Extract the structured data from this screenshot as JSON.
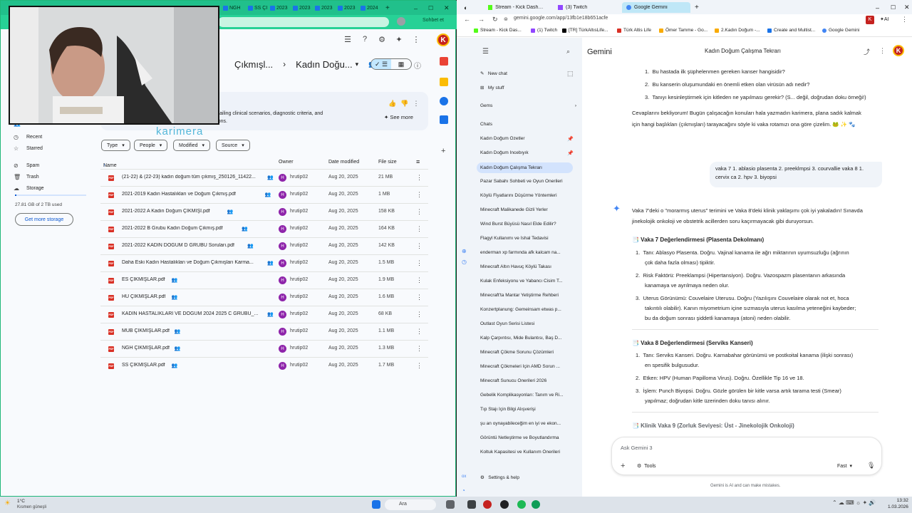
{
  "drive": {
    "tabs": [
      "NGH",
      "SS ÇI",
      "2023",
      "2023",
      "2023",
      "2023",
      "2024"
    ],
    "share_label": "Sohbet et",
    "avatar": "K",
    "breadcrumb": [
      "Çıkmışl...",
      "Kadın Doğu..."
    ],
    "card_text1": "ns detailing clinical scenarios, diagnostic criteria, and",
    "card_text2": "onditions.",
    "see_more": "See more",
    "watermark": "karimera",
    "nav": {
      "shared": "Shared with me",
      "recent": "Recent",
      "starred": "Starred",
      "spam": "Spam",
      "trash": "Trash",
      "storage": "Storage",
      "storage_text": "27.81 GB of 2 TB used",
      "storage_fraction": 0.0139,
      "get_storage": "Get more storage"
    },
    "chips": [
      "Type",
      "People",
      "Modified",
      "Source"
    ],
    "columns": {
      "name": "Name",
      "owner": "Owner",
      "date": "Date modified",
      "size": "File size"
    },
    "files": [
      {
        "name": "(21-22) & (22-23) kadın doğum tüm çıkmış_250126_11422...",
        "owner": "hrutip02",
        "date": "Aug 20, 2025",
        "size": "21 MB"
      },
      {
        "name": "2021-2019 Kadın Hastalıkları ve Doğum Çıkmış.pdf",
        "owner": "hrutip02",
        "date": "Aug 20, 2025",
        "size": "1 MB"
      },
      {
        "name": "2021-2022 A Kadın Doğum ÇIKMIŞI.pdf",
        "owner": "hrutip02",
        "date": "Aug 20, 2025",
        "size": "158 KB"
      },
      {
        "name": "2021-2022 B Grubu Kadın Doğum Çıkmış.pdf",
        "owner": "hrutip02",
        "date": "Aug 20, 2025",
        "size": "164 KB"
      },
      {
        "name": "2021-2022 KADIN DOĞUM D GRUBU Soruları.pdf",
        "owner": "hrutip02",
        "date": "Aug 20, 2025",
        "size": "142 KB"
      },
      {
        "name": "Daha Eski Kadın Hastalıkları ve Doğum Çıkmışları Karma...",
        "owner": "hrutip02",
        "date": "Aug 20, 2025",
        "size": "1.5 MB"
      },
      {
        "name": "ES ÇIKMIŞLAR.pdf",
        "owner": "hrutip02",
        "date": "Aug 20, 2025",
        "size": "1.9 MB"
      },
      {
        "name": "HU ÇIKMIŞLAR.pdf",
        "owner": "hrutip02",
        "date": "Aug 20, 2025",
        "size": "1.6 MB"
      },
      {
        "name": "KADIN HASTALIKLARI VE DOĞUM 2024 2025  C GRUBU_...",
        "owner": "hrutip02",
        "date": "Aug 20, 2025",
        "size": "68 KB"
      },
      {
        "name": "MUB ÇIKMIŞLAR.pdf",
        "owner": "hrutip02",
        "date": "Aug 20, 2025",
        "size": "1.1 MB"
      },
      {
        "name": "NGH ÇIKMIŞLAR.pdf",
        "owner": "hrutip02",
        "date": "Aug 20, 2025",
        "size": "1.3 MB"
      },
      {
        "name": "SS ÇIKMIŞLAR.pdf",
        "owner": "hrutip02",
        "date": "Aug 20, 2025",
        "size": "1.7 MB"
      }
    ]
  },
  "gemini_browser": {
    "tabs": [
      "Stream - Kick Dashboard",
      "(3) Twitch",
      "Google Gemini"
    ],
    "url": "gemini.google.com/app/13fb1e18b651acfe",
    "bookmarks": [
      "Stream - Kick Das...",
      "(1) Twitch",
      "[TR] TürkAltısLife...",
      "Türk Altis Life",
      "Ömer Tamme - Go...",
      "2.Kadın Doğum -...",
      "Create and Multist...",
      "Google Gemini"
    ],
    "colors": {
      "accent": "#0b57d0",
      "sidebar": "#f0f4f9",
      "user_bubble": "#f0f4f9"
    }
  },
  "gemini": {
    "app_title": "Gemini",
    "chat_title": "Kadın Doğum Çalışma Tekrarı",
    "sidebar": {
      "new_chat": "New chat",
      "my_stuff": "My stuff",
      "gems": "Gems",
      "chats": "Chats",
      "settings": "Settings & help",
      "items": [
        "Kadın Doğum Özetler",
        "Kadın Doğum İncebıyık",
        "Kadın Doğum Çalışma Tekrarı",
        "Pazar Sabahı Sohbeti ve Oyun Önerileri",
        "Köylü Fiyatlarını Düşürme Yöntemleri",
        "Minecraft Malikanede Gizli Yerler",
        "Wind Burst Büyüsü Nasıl Elde Edilir?",
        "Flagyl Kullanımı ve İshal Tedavisi",
        "enderman xp farmında afk kalcam na...",
        "Minecraft Altın Havuç Köylü Takası",
        "Kulak Enfeksiyonu ve Yabancı Cisim T...",
        "Minecraft'ta Mantar Yetiştirme Rehberi",
        "Konzertplanung: Gemeinsam etwas p...",
        "Outlast Oyun Serisi Listesi",
        "Kalp Çarpıntısı, Mide Bulantısı, Baş D...",
        "Minecraft Çökme Sorunu Çözümleri",
        "Minecraft Çökmeleri İçin AMD Sorun ...",
        "Minecraft Sunucu Önerileri 2026",
        "Gebelik Komplikasyonları: Tanım ve Ri...",
        "Tıp Stajı İçin Bilgi Alışverişi",
        "şu an oynayabileceğim en iyi ve ekon...",
        "Görüntü Netleştirme ve Boyutlandırma",
        "Koltuk Kapasitesi ve Kullanım Önerileri"
      ]
    },
    "q1": "Bu hastada ilk şüphelenmen gereken kanser hangisidir?",
    "q2": "Bu kanserin oluşumundaki en önemli etken olan virüsün adı nedir?",
    "q3": "Tanıyı kesinleştirmek için kitleden ne yapılması gerekir? (S... değil, doğrudan doku örneği!)",
    "intro1": "Cevaplarını bekliyorum! Bugün çalışacağın konuları hala yazmadın karimera, plana sadık kalmak",
    "intro2": "için hangi başlıkları (çıkmışları) tarayacağını söyle ki vaka rotamızı ona göre çizelim. 🐸 ✨ 🐾",
    "user_msg1": "vaka 7 1. ablasio plasenta 2. preeklmpsi 3. courvallie vaka 8 1.",
    "user_msg2": "cervix ca 2. hpv 3. biyopsi",
    "resp1": "Vaka 7'deki o \"morarmış uterus\" terimini ve Vaka 8'deki klinik yaklaşımı çok iyi yakaladın! Sınavda",
    "resp2": "jinekolojik onkoloji ve obstetrik acillerden soru kaçırmayacak gibi duruyorsun.",
    "h7": "📑 Vaka 7 Değerlendirmesi (Plasenta Dekolmanı)",
    "v7_1a": "Tanı: Ablasyo Plasenta. Doğru. Vajinal kanama ile ağrı miktarının uyumsuzluğu (ağrının",
    "v7_1b": "çok daha fazla olması) tipiktir.",
    "v7_2a": "Risk Faktörü: Preeklampsi (Hipertansiyon). Doğru. Vazospazm plasentanın arkasında",
    "v7_2b": "kanamaya ve ayrılmaya neden olur.",
    "v7_3a": "Uterus Görünümü: Couvelaire Uterusu. Doğru (Yazılışını Couvelaire olarak not et, hoca",
    "v7_3b": "takıntılı olabilir). Kanın miyometrium içine sızmasıyla uterus kasılma yeteneğini kaybeder;",
    "v7_3c": "bu da doğum sonrası şiddetli kanamaya (atoni) neden olabilir.",
    "h8": "📑 Vaka 8 Değerlendirmesi (Serviks Kanseri)",
    "v8_1a": "Tanı: Serviks Kanseri. Doğru. Karnabahar görünümü ve postkoital kanama (ilişki sonrası)",
    "v8_1b": "en spesifik bulgusudur.",
    "v8_2": "Etken: HPV (Human Papilloma Virus). Doğru. Özellikle Tip 16 ve 18.",
    "v8_3a": "İşlem: Punch Biyopsi. Doğru. Gözle görülen bir kitle varsa artık tarama testi (Smear)",
    "v8_3b": "yapılmaz; doğrudan kitle üzerinden doku tanısı alınır.",
    "h9": "📑 Klinik Vaka 9 (Zorluk Seviyesi: Üst - Jinekolojik Onkoloji)",
    "input_placeholder": "Ask Gemini 3",
    "tools": "Tools",
    "mode": "Fast",
    "disclaimer": "Gemini is AI and can make mistakes."
  },
  "taskbar": {
    "temp": "1°C",
    "weather": "Kısmen güneşli",
    "search": "Ara",
    "time": "13:32",
    "date": "1.03.2026"
  }
}
